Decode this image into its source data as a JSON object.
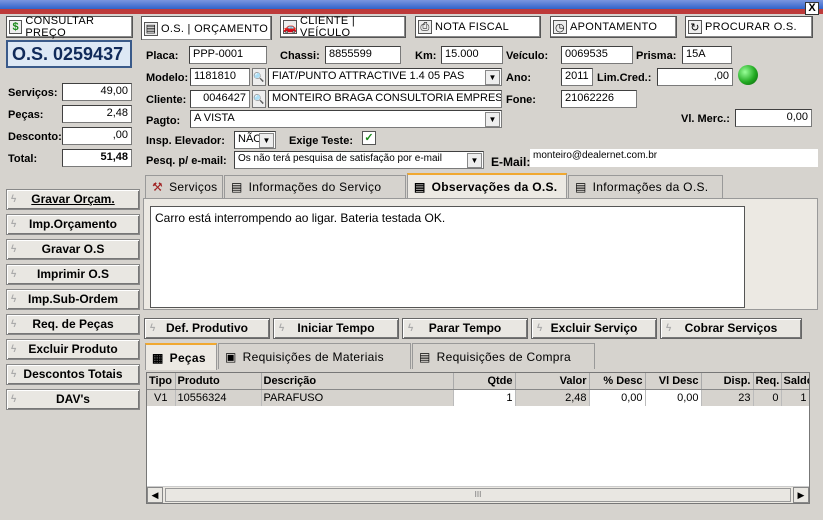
{
  "nav": {
    "consultar": "CONSULTAR PREÇO",
    "os_orc": "O.S. | ORÇAMENTO",
    "cliente": "CLIENTE | VEÍCULO",
    "nota": "NOTA FISCAL",
    "apont": "APONTAMENTO",
    "procurar": "PROCURAR O.S."
  },
  "close_label": "X",
  "os_number": "O.S. 0259437",
  "totals": {
    "servicos_label": "Serviços:",
    "servicos": "49,00",
    "pecas_label": "Peças:",
    "pecas": "2,48",
    "desconto_label": "Desconto:",
    "desconto": ",00",
    "total_label": "Total:",
    "total": "51,48"
  },
  "form": {
    "placa_label": "Placa:",
    "placa": "PPP-0001",
    "chassi_label": "Chassi:",
    "chassi": "8855599",
    "km_label": "Km:",
    "km": "15.000",
    "veiculo_label": "Veículo:",
    "veiculo": "0069535",
    "prisma_label": "Prisma:",
    "prisma": "15A",
    "modelo_label": "Modelo:",
    "modelo_code": "1181810",
    "modelo_desc": "FIAT/PUNTO ATTRACTIVE 1.4   05 PAS",
    "ano_label": "Ano:",
    "ano": "2011",
    "limcred_label": "Lim.Cred.:",
    "limcred": ",00",
    "cliente_label": "Cliente:",
    "cliente_code": "0046427",
    "cliente_name": "MONTEIRO BRAGA CONSULTORIA EMPRESARIA",
    "fone_label": "Fone:",
    "fone": "21062226",
    "pagto_label": "Pagto:",
    "pagto": "A VISTA",
    "vlmerc_label": "Vl. Merc.:",
    "vlmerc": "0,00",
    "insp_label": "Insp. Elevador:",
    "insp": "NÃO",
    "exige_label": "Exige Teste:",
    "pesq_label": "Pesq. p/ e-mail:",
    "pesq": "Os não terá pesquisa de satisfação por e-mail",
    "email_label": "E-Mail:",
    "email": "monteiro@dealernet.com.br"
  },
  "side_buttons": [
    "Gravar Orçam.",
    "Imp.Orçamento",
    "Gravar O.S",
    "Imprimir O.S",
    "Imp.Sub-Ordem",
    "Req. de Peças",
    "Excluir Produto",
    "Descontos Totais",
    "DAV's"
  ],
  "tabs": [
    "Serviços",
    "Informações do Serviço",
    "Observações da O.S.",
    "Informações da O.S."
  ],
  "observacao": "Carro está interrompendo ao ligar. Bateria testada OK.",
  "action_buttons": [
    "Def. Produtivo",
    "Iniciar Tempo",
    "Parar Tempo",
    "Excluir Serviço",
    "Cobrar Serviços"
  ],
  "subtabs": [
    "Peças",
    "Requisições de Materiais",
    "Requisições de Compra"
  ],
  "table": {
    "headers": [
      "Tipo",
      "Produto",
      "Descrição",
      "Qtde",
      "Valor",
      "% Desc",
      "Vl Desc",
      "Disp.",
      "Req.",
      "Saldo"
    ],
    "rows": [
      [
        "V1",
        "10556324",
        "PARAFUSO",
        "1",
        "2,48",
        "0,00",
        "0,00",
        "23",
        "0",
        "1"
      ]
    ]
  },
  "scroll_thumb": "III",
  "colors": {
    "titlebar": "#3163c9",
    "status_green": "#22aa22",
    "accent_tab": "#f0a830"
  }
}
